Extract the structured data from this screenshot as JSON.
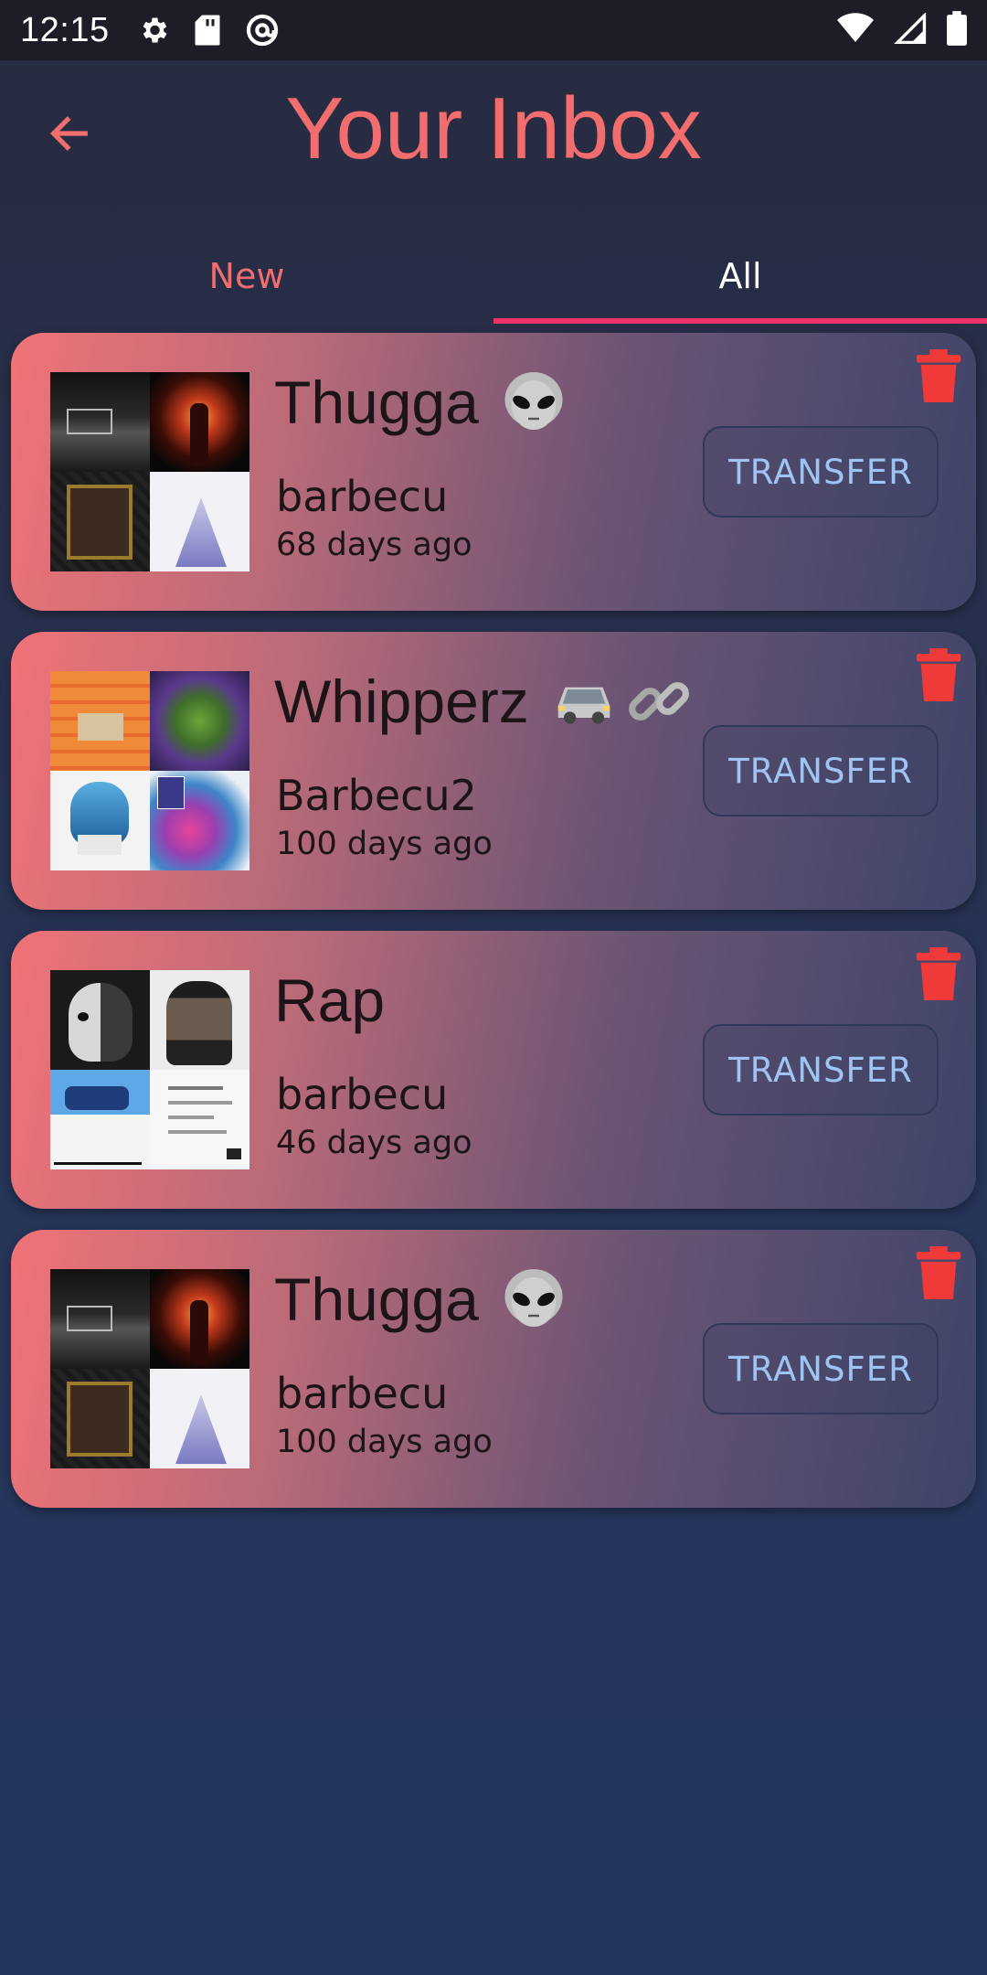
{
  "status_bar": {
    "time": "12:15",
    "left_icons": [
      "settings-icon",
      "sd-card-icon",
      "at-sign-icon"
    ],
    "right_icons": [
      "wifi-icon",
      "cell-signal-icon",
      "battery-icon"
    ]
  },
  "header": {
    "title": "Your Inbox",
    "back_icon": "arrow-back-icon"
  },
  "tabs": [
    {
      "label": "New",
      "selected": false
    },
    {
      "label": "All",
      "selected": true
    }
  ],
  "colors": {
    "accent": "#f26d6d",
    "tab_indicator": "#f0326a",
    "button_text": "#9fc4f4",
    "delete": "#f03a3a"
  },
  "inbox": [
    {
      "title": "Thugga",
      "emoji": [
        "alien-emoji"
      ],
      "user": "barbecu",
      "time": "68 days ago",
      "button_label": "TRANSFER",
      "delete_icon": "trash-icon"
    },
    {
      "title": "Whipperz",
      "emoji": [
        "car-emoji",
        "link-emoji"
      ],
      "user": "Barbecu2",
      "time": "100 days ago",
      "button_label": "TRANSFER",
      "delete_icon": "trash-icon"
    },
    {
      "title": "Rap",
      "emoji": [],
      "user": "barbecu",
      "time": "46 days ago",
      "button_label": "TRANSFER",
      "delete_icon": "trash-icon"
    },
    {
      "title": "Thugga",
      "emoji": [
        "alien-emoji"
      ],
      "user": "barbecu",
      "time": "100 days ago",
      "button_label": "TRANSFER",
      "delete_icon": "trash-icon"
    }
  ]
}
